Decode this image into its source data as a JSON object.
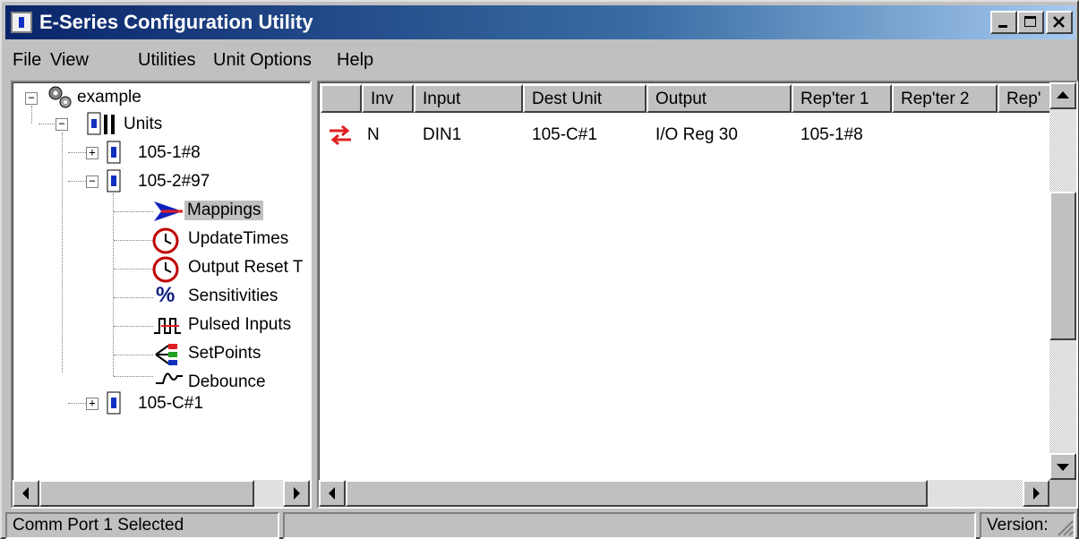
{
  "window": {
    "title": "E-Series Configuration Utility"
  },
  "menu": [
    "File",
    "View",
    "Utilities",
    "Unit Options",
    "Help"
  ],
  "tree": {
    "root": "example",
    "units": "Units",
    "unit1": "105-1#8",
    "unit2": "105-2#97",
    "children": [
      "Mappings",
      "UpdateTimes",
      "Output Reset T",
      "Sensitivities",
      "Pulsed Inputs",
      "SetPoints",
      "Debounce"
    ],
    "unit3": "105-C#1"
  },
  "table": {
    "columns": [
      "",
      "Inv",
      "Input",
      "Dest Unit",
      "Output",
      "Rep'ter 1",
      "Rep'ter 2",
      "Rep'"
    ],
    "rows": [
      {
        "inv": "N",
        "input": "DIN1",
        "dest": "105-C#1",
        "output": "I/O Reg 30",
        "rep1": "105-1#8"
      }
    ]
  },
  "status": {
    "left": "Comm Port 1 Selected",
    "middle": "",
    "right": "Version:"
  },
  "colors": {
    "title_start": "#0a246a",
    "title_end": "#a6caf0",
    "mapping_arrow": "#e02020"
  }
}
